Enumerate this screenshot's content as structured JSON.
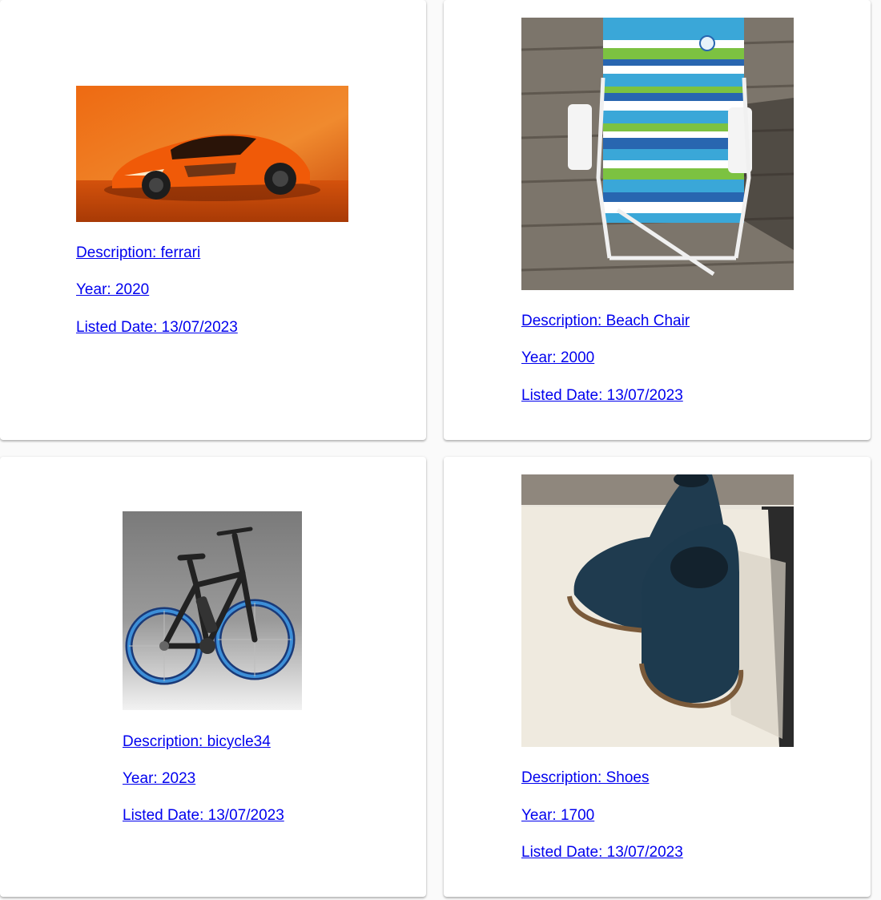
{
  "listings": [
    {
      "image": "orange-sports-car-photo",
      "description_label": "Description: ferrari",
      "year_label": "Year: 2020",
      "listed_label": "Listed Date: 13/07/2023"
    },
    {
      "image": "striped-beach-chair-photo",
      "description_label": "Description: Beach Chair",
      "year_label": "Year: 2000",
      "listed_label": "Listed Date: 13/07/2023"
    },
    {
      "image": "blue-bicycle-photo",
      "description_label": "Description: bicycle34",
      "year_label": "Year: 2023",
      "listed_label": "Listed Date: 13/07/2023"
    },
    {
      "image": "navy-shoes-photo",
      "description_label": "Description: Shoes",
      "year_label": "Year: 1700",
      "listed_label": "Listed Date: 13/07/2023"
    }
  ],
  "colors": {
    "link": "#0000ee",
    "card_background": "#ffffff",
    "page_background": "#fafafa"
  }
}
